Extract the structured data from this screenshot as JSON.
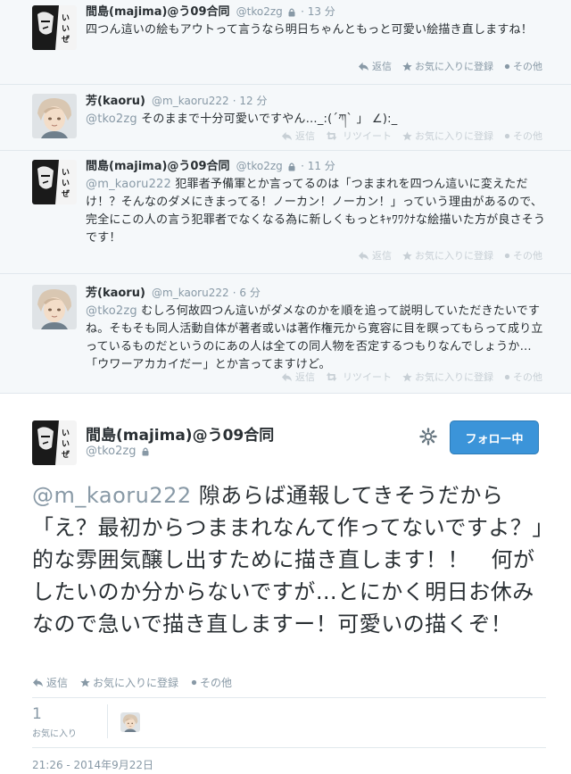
{
  "thread": [
    {
      "fullname": "間島(majima)@う09合同",
      "handle": "@tko2zg",
      "time": "· 13 分",
      "mention": "",
      "text": "四つん這いの絵もアウトって言うなら明日ちゃんともっと可愛い絵描き直しますね！",
      "actions": {
        "reply": "返信",
        "favorite": "お気に入りに登録",
        "more": "その他"
      }
    },
    {
      "fullname": "芳(kaoru)",
      "handle": "@m_kaoru222",
      "time": "· 12 分",
      "mention": "@tko2zg",
      "text": "そのままで十分可愛いですやん…_:(´ཀ` 」 ∠):_",
      "actions": {
        "reply": "返信",
        "retweet": "リツイート",
        "favorite": "お気に入りに登録",
        "more": "その他"
      }
    },
    {
      "fullname": "間島(majima)@う09合同",
      "handle": "@tko2zg",
      "time": "· 11 分",
      "mention": "@m_kaoru222",
      "text": "犯罪者予備軍とか言ってるのは「つままれを四つん這いに変えただけ！？そんなのダメにきまってる！ノーカン！ノーカン！」っていう理由があるので、完全にこの人の言う犯罪者でなくなる為に新しくもっとｷｬﾜﾜｸﾅな絵描いた方が良さそうです！",
      "actions": {
        "reply": "返信",
        "favorite": "お気に入りに登録",
        "more": "その他"
      }
    },
    {
      "fullname": "芳(kaoru)",
      "handle": "@m_kaoru222",
      "time": "· 6 分",
      "mention": "@tko2zg",
      "text": "むしろ何故四つん這いがダメなのかを順を追って説明していただきたいですね。そもそも同人活動自体が著者或いは著作権元から寛容に目を瞑ってもらって成り立っているものだというのにあの人は全ての同人物を否定するつもりなんでしょうか…「ウワーアカカイだー」とか言ってますけど。",
      "actions": {
        "reply": "返信",
        "retweet": "リツイート",
        "favorite": "お気に入りに登録",
        "more": "その他"
      }
    }
  ],
  "main": {
    "fullname": "間島(majima)@う09合同",
    "handle": "@tko2zg",
    "follow_label": "フォロー中",
    "mention": "@m_kaoru222",
    "text": " 隙あらば通報してきそうだから「え？最初からつままれなんて作ってないですよ？」的な雰囲気醸し出すために描き直します！！　何がしたいのか分からないですが…とにかく明日お休みなので急いで描き直しますー！可愛いの描くぞ！",
    "actions": {
      "reply": "返信",
      "favorite": "お気に入りに登録",
      "more": "その他"
    },
    "fav_count": "1",
    "fav_label": "お気に入り",
    "timestamp": "21:26 - 2014年9月22日"
  },
  "colors": {
    "accent": "#3b94d9",
    "muted": "#8899a6",
    "border": "#e1e8ed",
    "bg": "#f5f8fa"
  }
}
